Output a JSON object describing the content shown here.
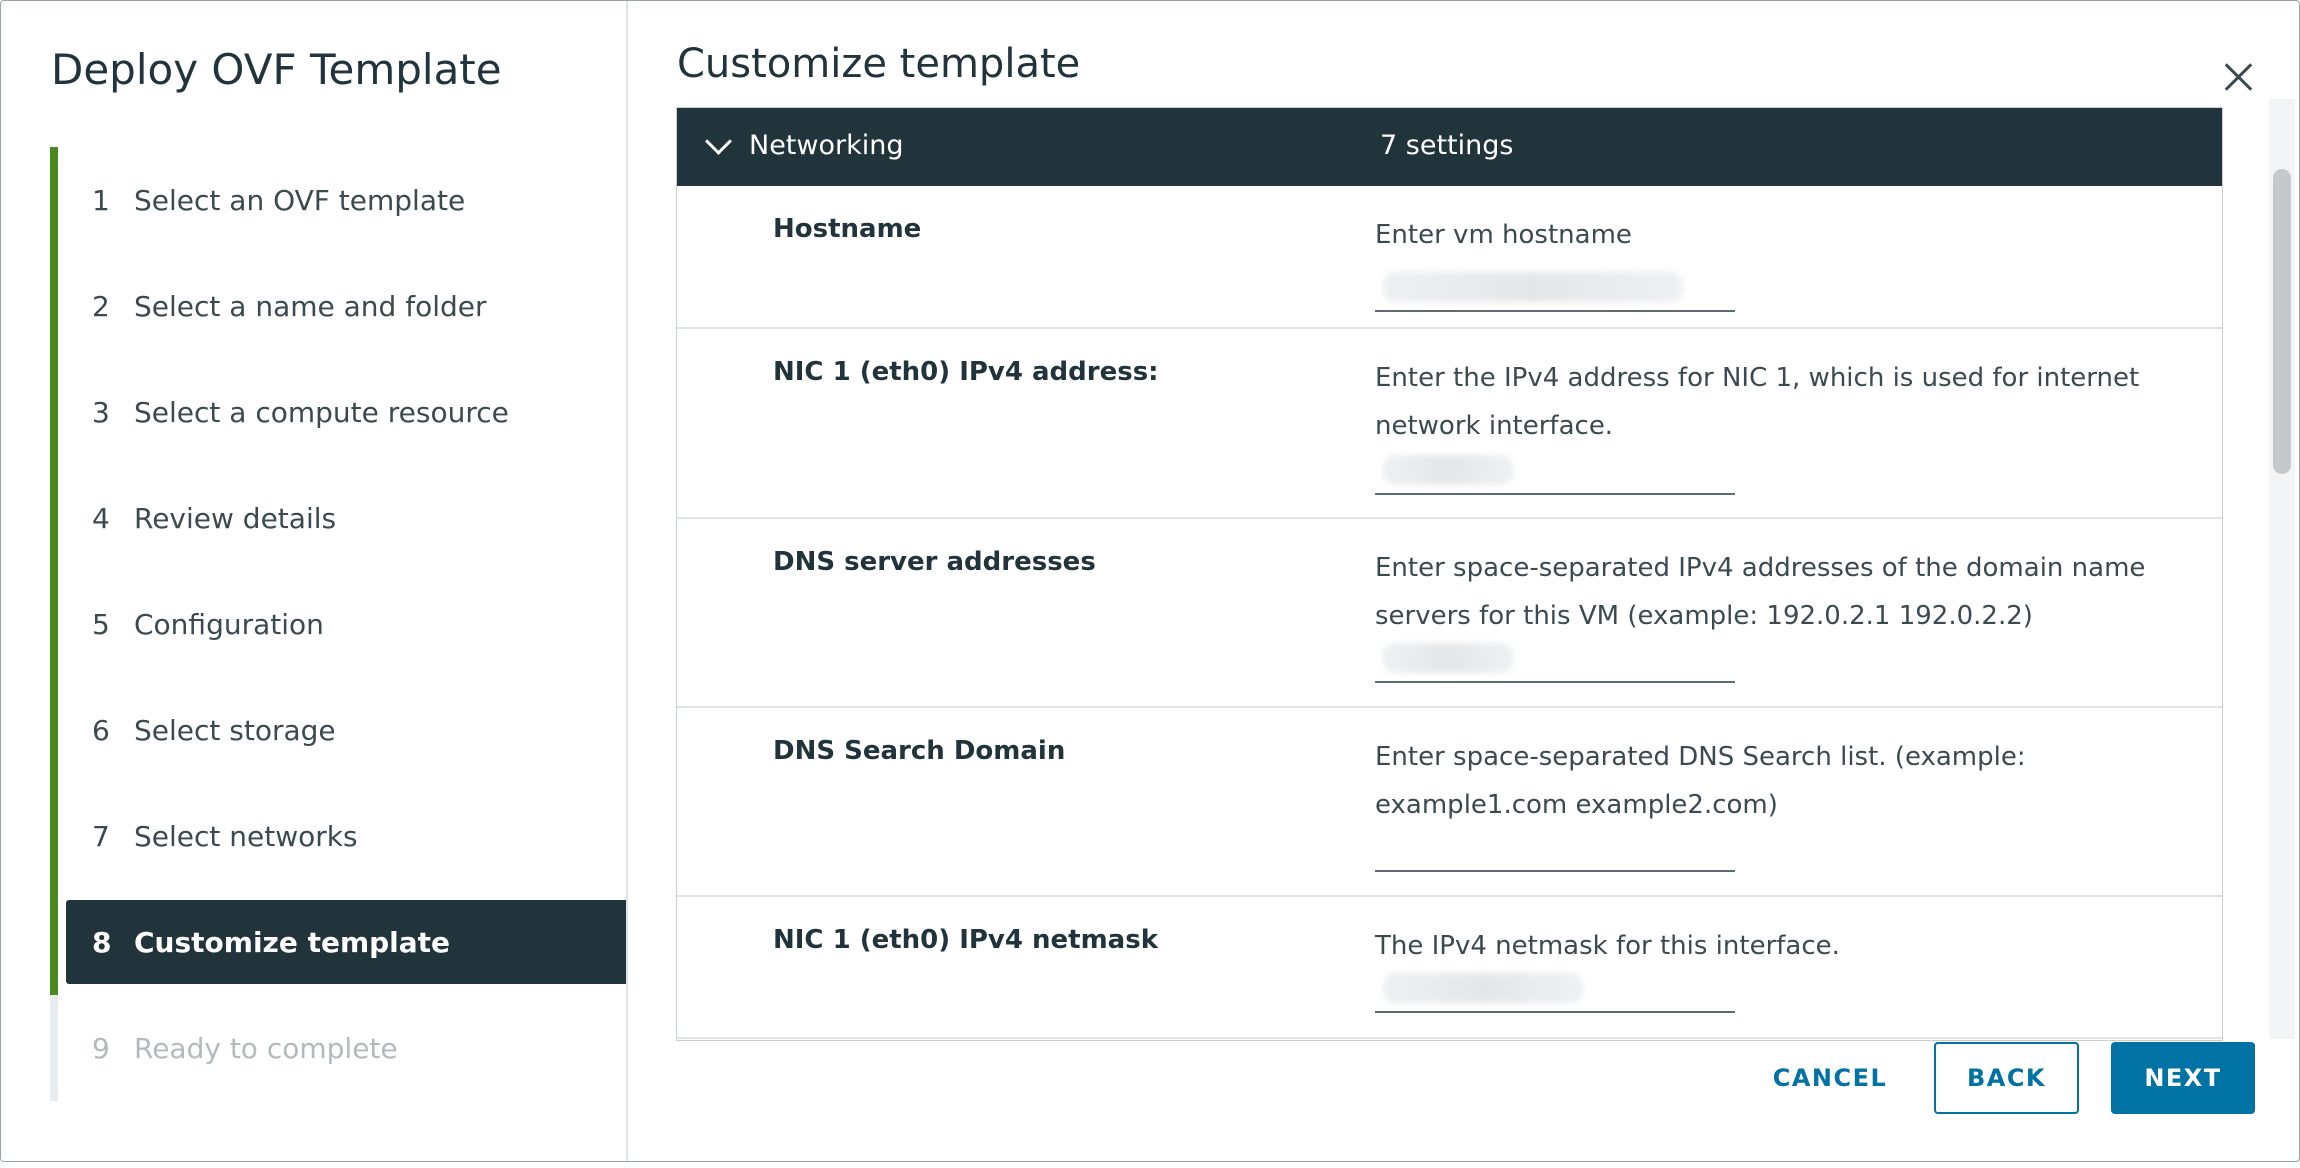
{
  "wizard": {
    "title": "Deploy OVF Template",
    "steps": [
      {
        "num": "1",
        "label": "Select an OVF template"
      },
      {
        "num": "2",
        "label": "Select a name and folder"
      },
      {
        "num": "3",
        "label": "Select a compute resource"
      },
      {
        "num": "4",
        "label": "Review details"
      },
      {
        "num": "5",
        "label": "Configuration"
      },
      {
        "num": "6",
        "label": "Select storage"
      },
      {
        "num": "7",
        "label": "Select networks"
      },
      {
        "num": "8",
        "label": "Customize template"
      },
      {
        "num": "9",
        "label": "Ready to complete"
      }
    ],
    "active_step": "8"
  },
  "content": {
    "title": "Customize template",
    "group": {
      "name": "Networking",
      "count": "7 settings"
    },
    "settings": [
      {
        "label": "Hostname",
        "description": "Enter vm hostname"
      },
      {
        "label": "NIC 1 (eth0) IPv4 address:",
        "description": "Enter the IPv4 address for NIC 1, which is used for internet network interface."
      },
      {
        "label": "DNS server addresses",
        "description": "Enter space-separated IPv4 addresses of the domain name servers for this VM (example: 192.0.2.1 192.0.2.2)"
      },
      {
        "label": "DNS Search Domain",
        "description": "Enter space-separated DNS Search list. (example:  example1.com example2.com)"
      },
      {
        "label": "NIC 1 (eth0) IPv4 netmask",
        "description": "The IPv4 netmask for this interface."
      }
    ]
  },
  "footer": {
    "cancel_label": "CANCEL",
    "back_label": "BACK",
    "next_label": "NEXT"
  },
  "colors": {
    "accent": "#0072a3",
    "header_dark": "#21333b",
    "step_complete": "#4b8a1f"
  },
  "icons": {
    "close": "close-icon",
    "collapse": "chevron-down-icon"
  }
}
